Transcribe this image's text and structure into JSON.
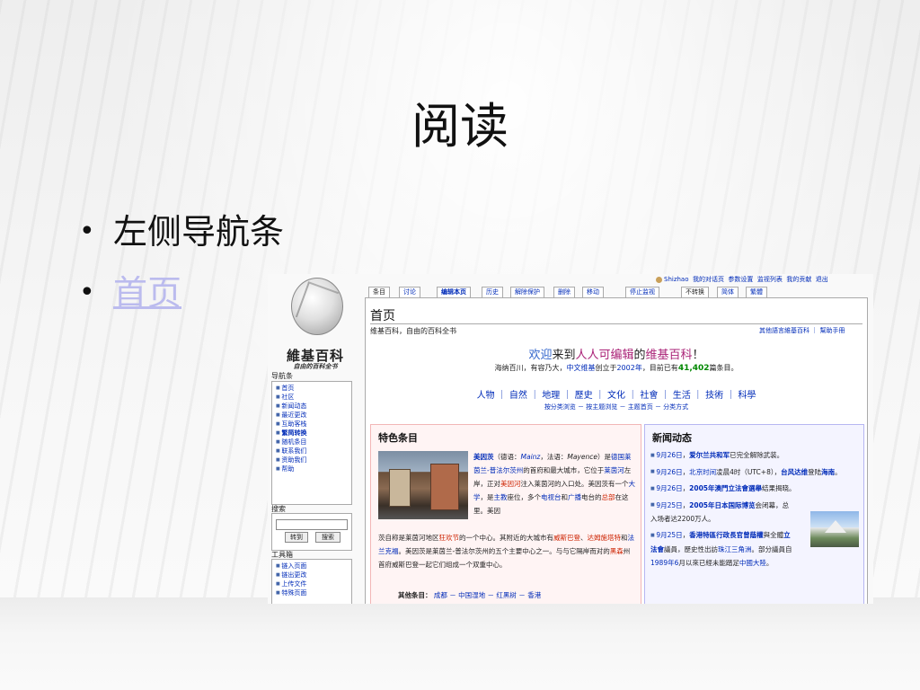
{
  "slide": {
    "title": "阅读",
    "bullets": [
      "左侧导航条",
      "首页"
    ]
  },
  "wiki": {
    "logo_text": "維基百科",
    "logo_sub": "自由的百科全书",
    "nav_heading": "导航条",
    "nav_items": [
      "首页",
      "社区",
      "新闻动态",
      "最近更改",
      "互助客栈",
      "繁简转换",
      "随机条目",
      "联系我们",
      "资助我们",
      "帮助"
    ],
    "search_heading": "搜索",
    "search_go": "转到",
    "search_button": "搜索",
    "toolbox_heading": "工具箱",
    "toolbox_items": [
      "链入页面",
      "链出更改",
      "上传文件",
      "特殊页面"
    ],
    "user_name": "Shizhao",
    "user_links": [
      "我的对话页",
      "参数设置",
      "监视列表",
      "我的贡献",
      "退出"
    ],
    "tabs": [
      "条目",
      "讨论",
      "编辑本页",
      "历史",
      "解除保护",
      "删除",
      "移动",
      "停止监视",
      "不转换",
      "简体",
      "繁體"
    ],
    "page_heading": "首页",
    "site_sub": "维基百科，自由的百科全书",
    "other_lang": "其他語言維基百科 ｜ 幫助手冊",
    "welcome_pre": "欢迎",
    "welcome_to": "来到",
    "welcome_free": "人人可编辑",
    "welcome_of": "的",
    "welcome_wiki": "维基百科",
    "welcome_end": "！",
    "stats_1": "海纳百川，有容乃大，",
    "stats_link": "中文维基",
    "stats_2": "创立于",
    "stats_year": "2002年",
    "stats_3": "，目前已有",
    "stats_count": "41,402",
    "stats_4": "篇条目。",
    "categories": "人物 ｜ 自然 ｜ 地理 ｜ 歷史 ｜ 文化 ｜ 社會 ｜ 生活 ｜ 技術 ｜ 科學",
    "browse": "按分类浏览 － 按主题浏览 － 主题首页 － 分类方式",
    "featured_heading": "特色条目",
    "feat_1": "美因茨",
    "feat_2": "（德语：",
    "feat_3": "Mainz",
    "feat_4": "，法语：",
    "feat_5": "Mayence",
    "feat_6": "）是",
    "feat_7": "德国莱茵兰-普法尔茨州",
    "feat_8": "的首府和最大城市，它位于",
    "feat_9": "莱茵河",
    "feat_10": "左岸，正对",
    "feat_11": "美因河",
    "feat_12": "注入莱茵河的入口处。美因茨有一个",
    "feat_13": "大学",
    "feat_14": "，是",
    "feat_15": "主教",
    "feat_16": "座位，多个",
    "feat_17": "电视台",
    "feat_18": "和",
    "feat_19": "广播",
    "feat_20": "电台的",
    "feat_21": "总部",
    "feat_22": "在这里。美因",
    "feat2_1": "茨自称是莱茵河地区",
    "feat2_2": "狂欢节",
    "feat2_3": "的一个中心。其附近的大城市有",
    "feat2_4": "威斯巴登",
    "feat2_5": "、",
    "feat2_6": "达姆施塔特",
    "feat2_7": "和",
    "feat2_8": "法兰克福",
    "feat2_9": "。美因茨是莱茵兰-普法尔茨州的五个主要中心之一。与与它隔岸而对的",
    "feat2_10": "黑森",
    "feat2_11": "州首府威斯巴登一起它们组成一个双重中心。",
    "other_label": "其他条目：",
    "other_items": "成都 － 中国湿地 － 红黑树 － 香港",
    "news_heading": "新闻动态",
    "news_1_date": "9月26日",
    "news_1_a": "，",
    "news_1_link": "爱尔兰共和军",
    "news_1_b": "已完全解除武装。",
    "news_2_date": "9月26日",
    "news_2_a": "，",
    "news_2_link": "北京时间",
    "news_2_b": "凌晨4时（UTC+8），",
    "news_2_link2": "台风达维",
    "news_2_c": "登陆",
    "news_2_link3": "海南",
    "news_2_d": "。",
    "news_3_date": "9月26日",
    "news_3_a": "，",
    "news_3_link": "2005年澳門立法會選舉",
    "news_3_b": "结果揭晓。",
    "news_4_date": "9月25日",
    "news_4_a": "，",
    "news_4_link": "2005年日本国际博览",
    "news_4_b": "会闭幕，总入场者达2200万人。",
    "news_5_date": "9月25日",
    "news_5_a": "，",
    "news_5_link": "香港特區行政長官曾蔭權",
    "news_5_b": "與全體",
    "news_5_link2": "立法會",
    "news_5_c": "議員，歷史性出訪",
    "news_5_link3": "珠江三角洲",
    "news_5_d": "。部分議員自",
    "news_5_link4": "1989年6",
    "news_5_e": "月以來已經未能踏足",
    "news_5_link5": "中國大陸",
    "news_5_f": "。"
  },
  "colors": {
    "link": "#002bb8",
    "red_link": "#cc2200",
    "count_green": "#008800",
    "featured_bg": "#fff4f4",
    "news_bg": "#f4f4ff"
  }
}
